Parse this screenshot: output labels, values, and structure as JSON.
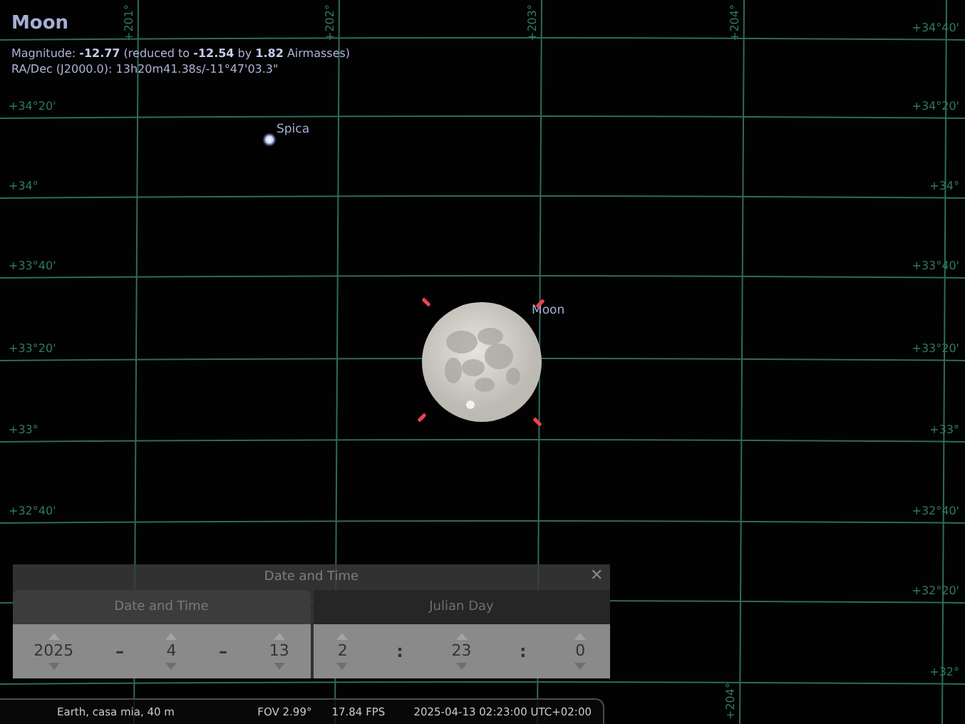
{
  "object_info": {
    "title": "Moon",
    "lines": [
      "Magnitude: **-12.77** (reduced to **-12.54** by **1.82** Airmasses)",
      "RA/Dec (J2000.0): 13h20m41.38s/-11°47'03.3\""
    ]
  },
  "sky": {
    "objects": [
      {
        "kind": "star",
        "label": "Spica",
        "selected": false
      },
      {
        "kind": "moon",
        "label": "Moon",
        "selected": true
      }
    ],
    "grid_labels_left": [
      "+34°20'",
      "+34°",
      "+33°40'",
      "+33°20'",
      "+33°",
      "+32°40'"
    ],
    "grid_labels_right": [
      "+34°40'",
      "+34°20'",
      "+34°",
      "+33°40'",
      "+33°20'",
      "+33°",
      "+32°40'",
      "+32°20'",
      "+32°"
    ],
    "grid_labels_top": [
      "+201°",
      "+202°",
      "+203°",
      "+204°"
    ],
    "grid_labels_bottom": [
      "+204°"
    ]
  },
  "dialog": {
    "title": "Date and Time",
    "close": "✕",
    "tabs": [
      {
        "label": "Date and Time",
        "selected": true
      },
      {
        "label": "Julian Day",
        "selected": false
      }
    ],
    "groups": [
      [
        {
          "kind": "spinner",
          "value": "2025"
        },
        {
          "kind": "separator",
          "text": "–"
        },
        {
          "kind": "spinner",
          "value": "4"
        },
        {
          "kind": "separator",
          "text": "–"
        },
        {
          "kind": "spinner",
          "value": "13"
        }
      ],
      [
        {
          "kind": "spinner",
          "value": "2"
        },
        {
          "kind": "separator",
          "text": ":"
        },
        {
          "kind": "spinner",
          "value": "23"
        },
        {
          "kind": "separator",
          "text": ":"
        },
        {
          "kind": "spinner",
          "value": "0"
        }
      ]
    ]
  },
  "status_bar": {
    "location": "Earth, casa mia, 40 m",
    "fov": "FOV 2.99°",
    "fps": "17.84 FPS",
    "datetime": "2025-04-13 02:23:00 UTC+02:00"
  }
}
